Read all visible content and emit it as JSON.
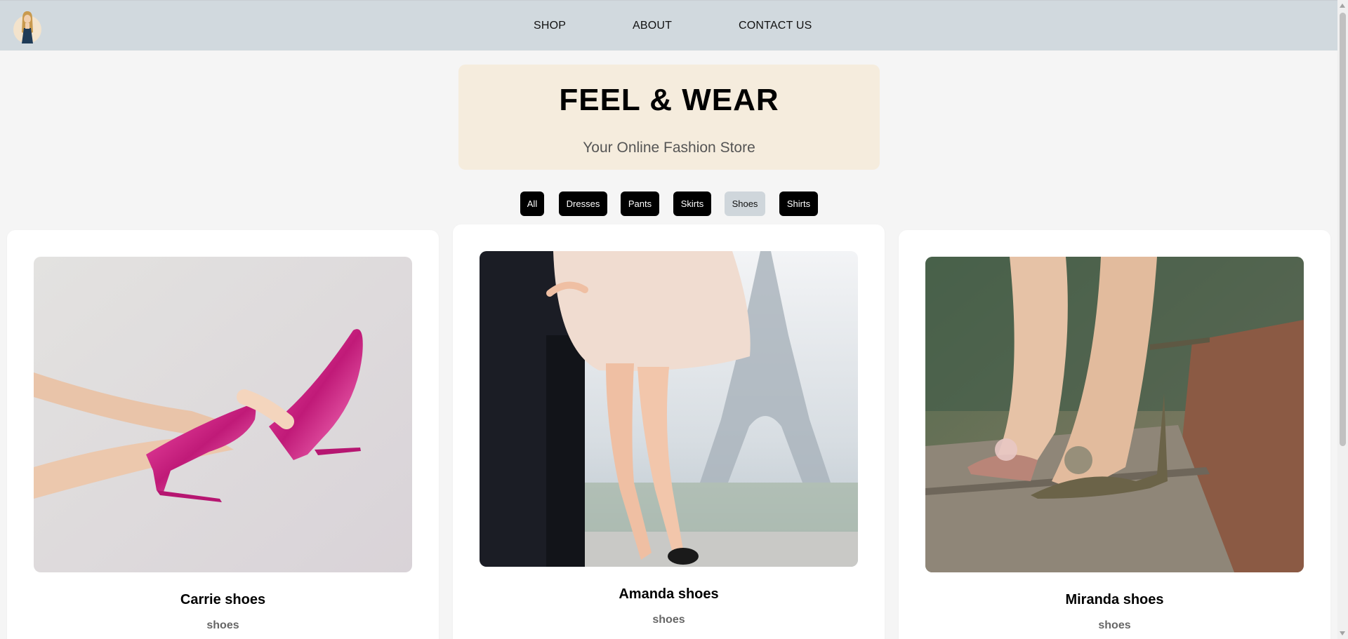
{
  "nav": {
    "items": [
      {
        "label": "SHOP"
      },
      {
        "label": "ABOUT"
      },
      {
        "label": "CONTACT US"
      }
    ]
  },
  "hero": {
    "title": "FEEL & WEAR",
    "subtitle": "Your Online Fashion Store"
  },
  "filters": {
    "items": [
      {
        "label": "All"
      },
      {
        "label": "Dresses"
      },
      {
        "label": "Pants"
      },
      {
        "label": "Skirts"
      },
      {
        "label": "Shoes"
      },
      {
        "label": "Shirts"
      }
    ],
    "active": "Shoes"
  },
  "products": [
    {
      "name": "Carrie shoes",
      "category": "shoes"
    },
    {
      "name": "Amanda shoes",
      "category": "shoes"
    },
    {
      "name": "Miranda shoes",
      "category": "shoes"
    }
  ],
  "colors": {
    "navbar": "#d1d9de",
    "hero_bg": "#f5ecdd",
    "filter_bg": "#000000",
    "filter_active_bg": "#cfd6db"
  }
}
